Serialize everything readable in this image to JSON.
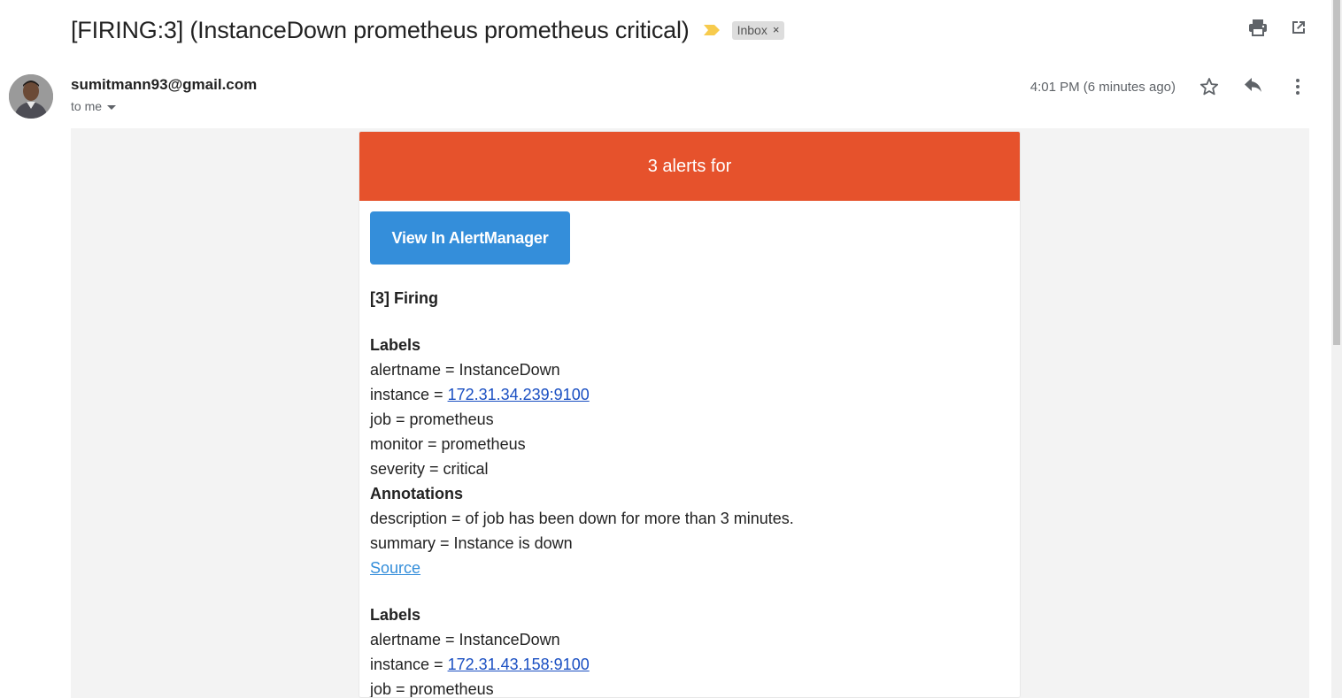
{
  "email": {
    "subject": "[FIRING:3] (InstanceDown prometheus prometheus critical)",
    "label": "Inbox",
    "label_close": "×",
    "sender": "sumitmann93@gmail.com",
    "recipient_line": "to me",
    "time": "4:01 PM (6 minutes ago)"
  },
  "icons": {
    "print": "print-icon",
    "popout": "open-in-new-window-icon",
    "star": "star-icon",
    "reply": "reply-icon",
    "more": "more-vert-icon",
    "importance": "importance-marker-icon"
  },
  "colors": {
    "header_red": "#e6522c",
    "button_blue": "#348eda",
    "importance_yellow": "#f7cb4d"
  },
  "alert": {
    "header_text": "3 alerts for",
    "button_label": "View In AlertManager",
    "firing_title": "[3] Firing",
    "alerts": [
      {
        "labels_heading": "Labels",
        "alertname": "alertname = InstanceDown",
        "instance_prefix": "instance = ",
        "instance_link": "172.31.34.239:9100",
        "job": "job = prometheus",
        "monitor": "monitor = prometheus",
        "severity": "severity = critical",
        "annotations_heading": "Annotations",
        "description": "description = of job has been down for more than 3 minutes.",
        "summary": "summary = Instance is down",
        "source_link": "Source"
      },
      {
        "labels_heading": "Labels",
        "alertname": "alertname = InstanceDown",
        "instance_prefix": "instance = ",
        "instance_link": "172.31.43.158:9100",
        "job": "job = prometheus"
      }
    ]
  }
}
